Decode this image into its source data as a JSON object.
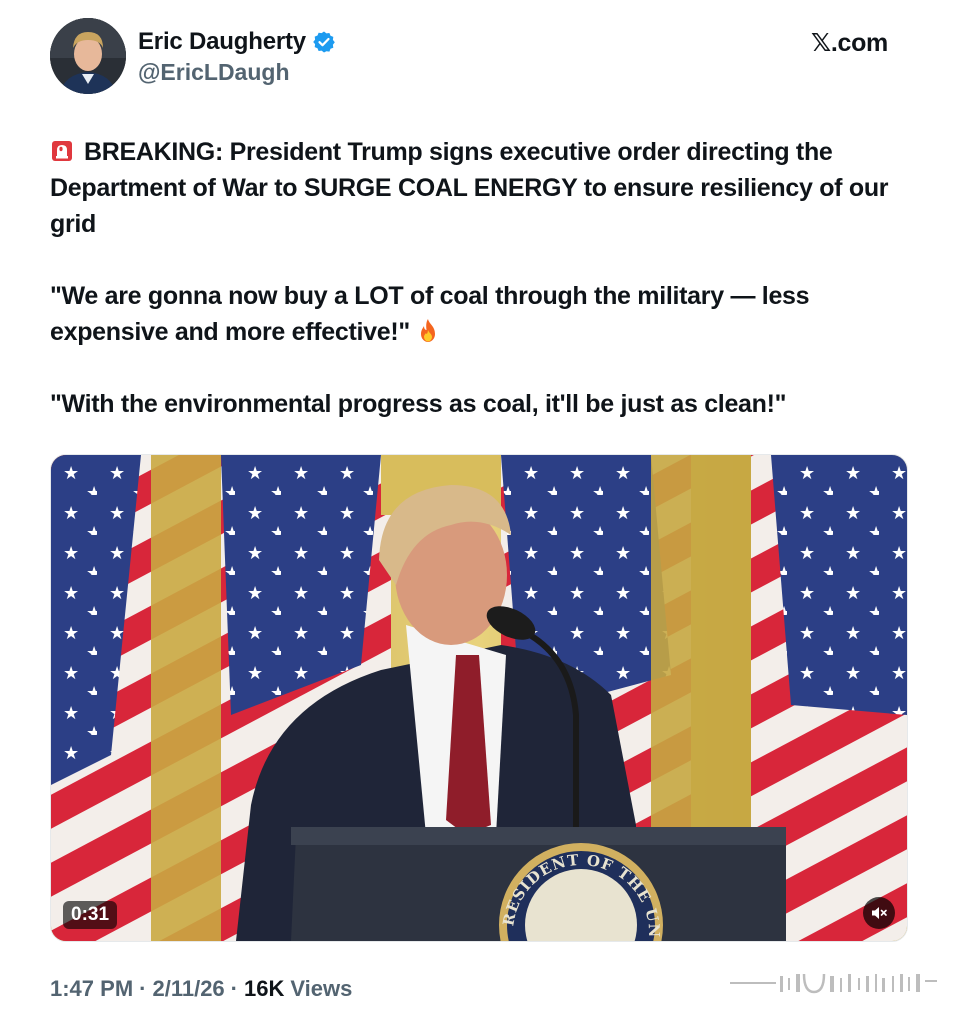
{
  "author": {
    "name": "Eric Daugherty",
    "handle": "@EricLDaugh",
    "verified": true
  },
  "site_label": "𝕏.com",
  "tweet": {
    "line1": "BREAKING: President Trump signs executive order directing the Department of War to SURGE COAL ENERGY to ensure resiliency of our grid",
    "line2": "\"We are gonna now buy a LOT of coal through the military — less expensive and more effective!\"",
    "line3": "\"With the environmental progress as coal, it'll be just as clean!\"",
    "icons": [
      "siren-icon",
      "fire-icon"
    ]
  },
  "media": {
    "duration": "0:31",
    "seal_text": "RESIDENT OF THE UNIT",
    "mute_icon": "speaker-muted-icon"
  },
  "meta": {
    "time": "1:47 PM",
    "date": "2/11/26",
    "views_count": "16K",
    "views_label": "Views",
    "separator": "·"
  },
  "colors": {
    "text": "#0f1419",
    "secondary_text": "#536471",
    "verified_blue": "#1d9bf0"
  }
}
